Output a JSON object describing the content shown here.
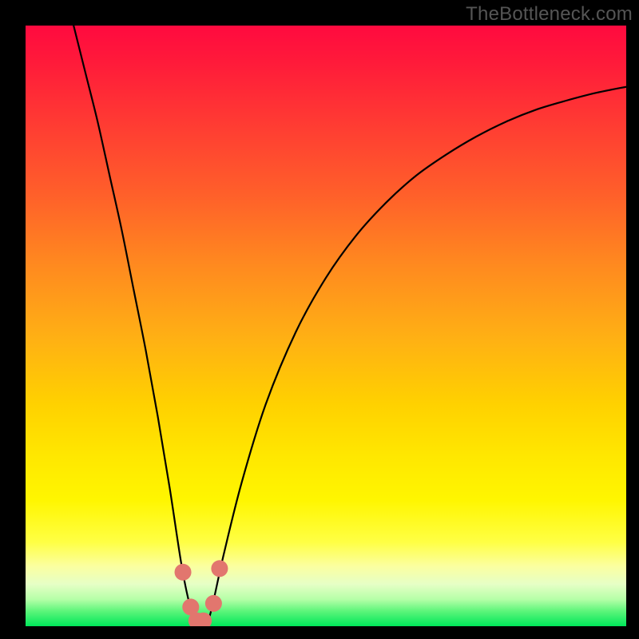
{
  "watermark": "TheBottleneck.com",
  "colors": {
    "page_bg": "#000000",
    "curve": "#000000",
    "marker_fill": "#e2766e",
    "marker_stroke": "#e2766e"
  },
  "chart_data": {
    "type": "line",
    "title": "",
    "xlabel": "",
    "ylabel": "",
    "xlim": [
      0,
      100
    ],
    "ylim": [
      0,
      100
    ],
    "grid": false,
    "legend": false,
    "series": [
      {
        "name": "curve",
        "x": [
          8,
          10,
          12,
          14,
          16,
          18,
          20,
          22,
          24,
          26,
          27.5,
          29,
          30,
          31,
          33,
          36,
          40,
          45,
          50,
          55,
          60,
          65,
          70,
          75,
          80,
          85,
          90,
          95,
          100
        ],
        "y": [
          100,
          92,
          84,
          75,
          66,
          56,
          46,
          35,
          23,
          10,
          3,
          0,
          0,
          3,
          12,
          24,
          37,
          49,
          58,
          65,
          70.5,
          75,
          78.5,
          81.5,
          84,
          86,
          87.5,
          88.8,
          89.8
        ]
      }
    ],
    "markers": [
      {
        "x": 26.2,
        "y": 9.0,
        "r": 1.0
      },
      {
        "x": 27.5,
        "y": 3.2,
        "r": 1.0
      },
      {
        "x": 28.5,
        "y": 0.9,
        "r": 1.0
      },
      {
        "x": 29.6,
        "y": 0.9,
        "r": 1.0
      },
      {
        "x": 31.3,
        "y": 3.8,
        "r": 1.0
      },
      {
        "x": 32.3,
        "y": 9.6,
        "r": 1.0
      }
    ],
    "note": "Values are estimated by reading pixel positions off the unlabeled axes; x and y are in percent of the plot area with origin at bottom-left."
  }
}
